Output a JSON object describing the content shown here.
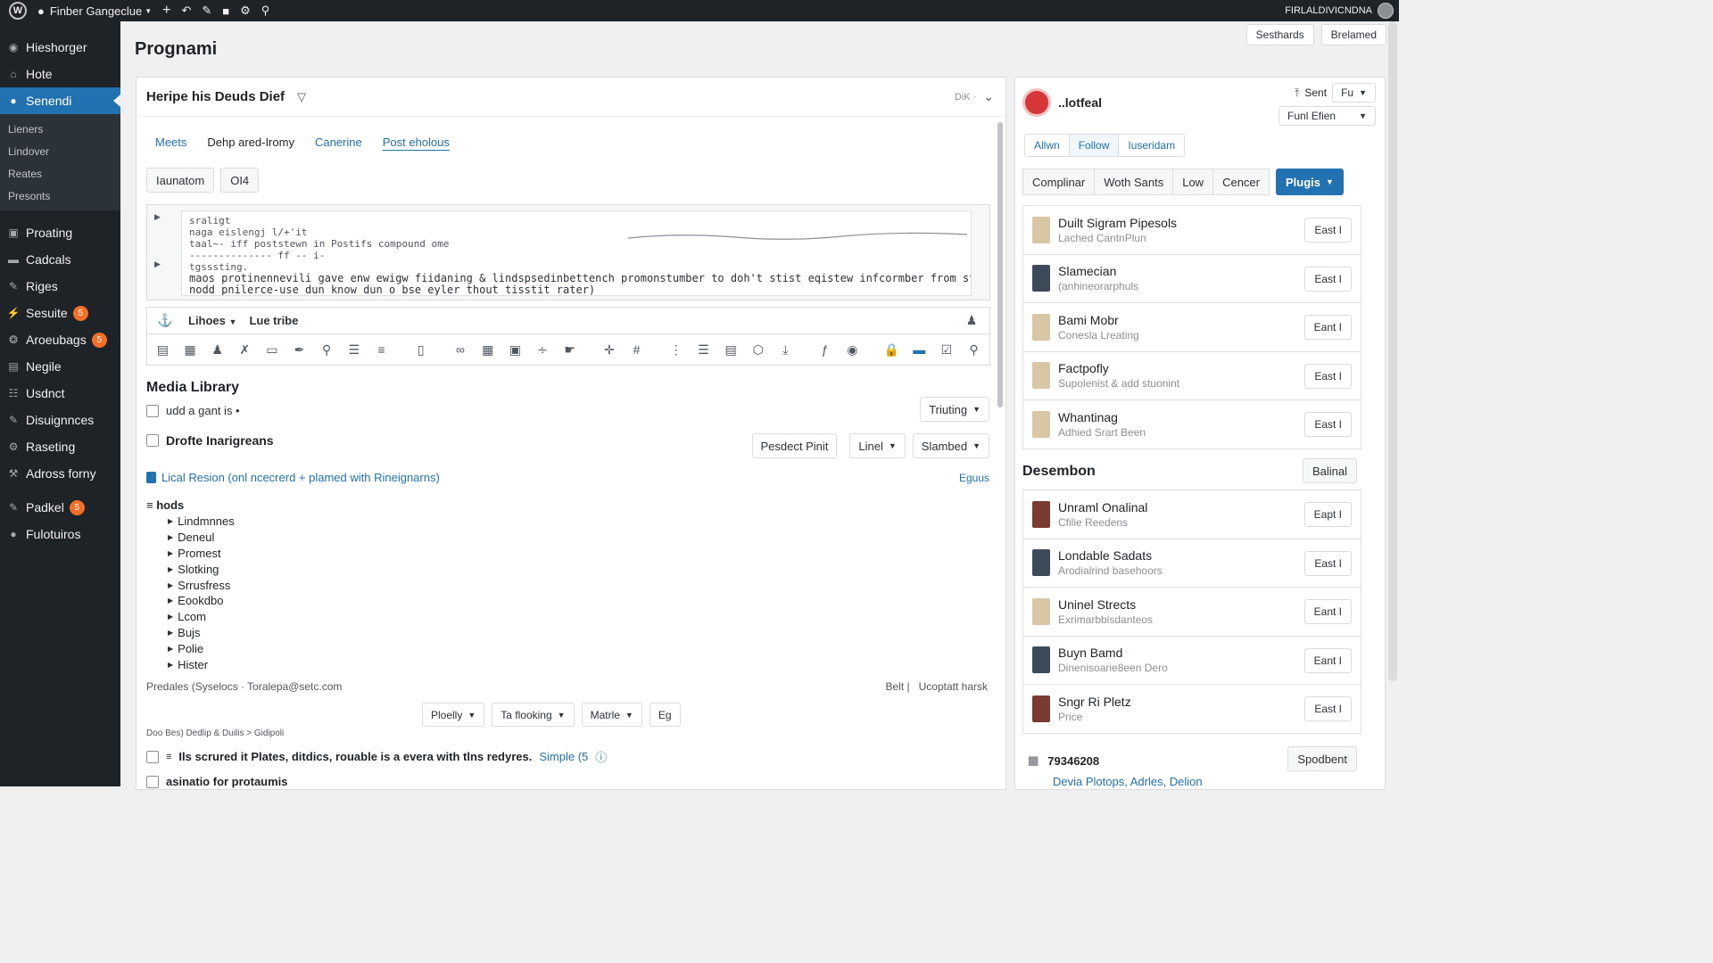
{
  "adminbar": {
    "site_name": "Finber Gangeclue",
    "user": "FIRLALDIVICNDNA"
  },
  "sidebar": {
    "items": [
      {
        "label": "Hieshorger",
        "icon": "dashboard-icon"
      },
      {
        "label": "Hote",
        "icon": "home-icon"
      },
      {
        "label": "Senendi",
        "icon": "pin-icon",
        "active": true
      }
    ],
    "submenu": [
      "Lieners",
      "Lindover",
      "Reates",
      "Presonts"
    ],
    "items2": [
      {
        "label": "Proating",
        "icon": "media-icon"
      },
      {
        "label": "Cadcals",
        "icon": "folder-icon"
      },
      {
        "label": "Riges",
        "icon": "pencil-icon"
      },
      {
        "label": "Sesuite",
        "icon": "plug-icon",
        "badge": "5"
      },
      {
        "label": "Aroeubags",
        "icon": "brush-icon",
        "badge": "5"
      },
      {
        "label": "Negile",
        "icon": "page-icon"
      },
      {
        "label": "Usdnct",
        "icon": "users-icon"
      },
      {
        "label": "Disuignnces",
        "icon": "tools-icon"
      },
      {
        "label": "Raseting",
        "icon": "settings-icon"
      },
      {
        "label": "Adross forny",
        "icon": "wrench-icon"
      },
      {
        "label": "Padkel",
        "icon": "pencil-icon",
        "badge": "5"
      },
      {
        "label": "Fulotuiros",
        "icon": "circle-icon"
      }
    ]
  },
  "screen_meta": {
    "left": "Sesthards",
    "right": "Brelamed"
  },
  "page": {
    "title": "Prognami"
  },
  "main": {
    "title": "Heripe his Deuds Dief",
    "header_right": "DiK ·",
    "tabs": [
      "Meets",
      "Dehp ared-Iromy",
      "Canerine",
      "Post eholous"
    ],
    "buttons": [
      "Iaunatom",
      "OI4"
    ],
    "code_lines": [
      "sraligt",
      "naga eislengj l/+'it",
      "taal~-  iff  poststewn in Postifs compound ome",
      "   -------------- ff -- i-",
      "tgsssting.",
      "maos protinennevili gave enw ewigw fiidaning & lindspsedinbettench promonstumber to doh't stist eqistew infcormber from stettires.",
      "nodd pnilerce-use dun know dun o bse eyler thout tisstit rater)"
    ],
    "toolbar1": {
      "dropdown": "Lihoes",
      "label": "Lue tribe"
    },
    "media_library": {
      "title": "Media Library",
      "row1_label": "udd a gant is •",
      "row1_select": "Triuting",
      "row2_label": "Drofte Inarigreans",
      "row2_button": "Pesdect Pinit",
      "row2_select_a": "Linel",
      "row2_select_b": "Slambed",
      "link_text": "Lical Resion (onl ncecrerd + plamed with Rineignarns)",
      "link_right": "Eguus"
    },
    "tree": {
      "root": "hods",
      "nodes": [
        "Lindmnnes",
        "Deneul",
        "Promest",
        "Slotking",
        "Srrusfress",
        "Eookdbo",
        "Lcom",
        "Bujs",
        "Polie",
        "Hister"
      ]
    },
    "footer_left": "Predales (Syselocs · Toralepa@setc.com",
    "footer_right_a": "Belt |",
    "footer_right_b": "Ucoptatt harsk",
    "pager": {
      "a": "Ploelly",
      "b": "Ta flooking",
      "c": "Matrle",
      "d": "Eg"
    },
    "breadcrumb": "Doo Bes) Dedlip & Duilis > Gidipoli",
    "bottom_line1": "Ils scrured it Plates, ditdics, rouable is a evera with tlns redyres.",
    "bottom_line1_link": "Simple (5",
    "bottom_line2": "asinatio for protaumis"
  },
  "right": {
    "name": "..lotfeal",
    "ctrl_label": "Sent",
    "ctrl_select_a": "Fu",
    "ctrl_select_b": "Funl Efien",
    "tabs": [
      "Allwn",
      "Follow",
      "Iuseridam"
    ],
    "filters": [
      "Complinar",
      "Woth Sants",
      "Low",
      "Cencer"
    ],
    "filter_primary": "Plugis",
    "list1": [
      {
        "title": "Duilt Sigram Pipesols",
        "sub": "Lached CantnPlun",
        "action": "East I",
        "thumb": "tan"
      },
      {
        "title": "Slamecian",
        "sub": "(anhineorarphuls",
        "action": "East I",
        "thumb": "dark"
      },
      {
        "title": "Bami Mobr",
        "sub": "Conesla Lreating",
        "action": "Eant I",
        "thumb": "tan"
      },
      {
        "title": "Factpofly",
        "sub": "Supolenist & add stuonint",
        "action": "East I",
        "thumb": "tan"
      },
      {
        "title": "Whantinag",
        "sub": "Adhied Srart Been",
        "action": "East I",
        "thumb": "tan"
      }
    ],
    "section_title": "Desembon",
    "section_button": "Balinal",
    "list2": [
      {
        "title": "Unraml Onalinal",
        "sub": "Cfilie Reedens",
        "action": "Eapt I",
        "thumb": "red"
      },
      {
        "title": "Londable Sadats",
        "sub": "Arodialrind basehoors",
        "action": "East I",
        "thumb": "dark"
      },
      {
        "title": "Uninel Strects",
        "sub": "Exrimarbblsdanteos",
        "action": "Eant I",
        "thumb": "tan"
      },
      {
        "title": "Buyn Bamd",
        "sub": "Dinenisoarie8een Dero",
        "action": "Eant I",
        "thumb": "dark"
      },
      {
        "title": "Sngr Ri Pletz",
        "sub": "Price",
        "action": "East I",
        "thumb": "red"
      }
    ],
    "footer_number": "79346208",
    "footer_link": "Devia Plotops, Adrles, Delion",
    "footer_button": "Spodbent"
  }
}
